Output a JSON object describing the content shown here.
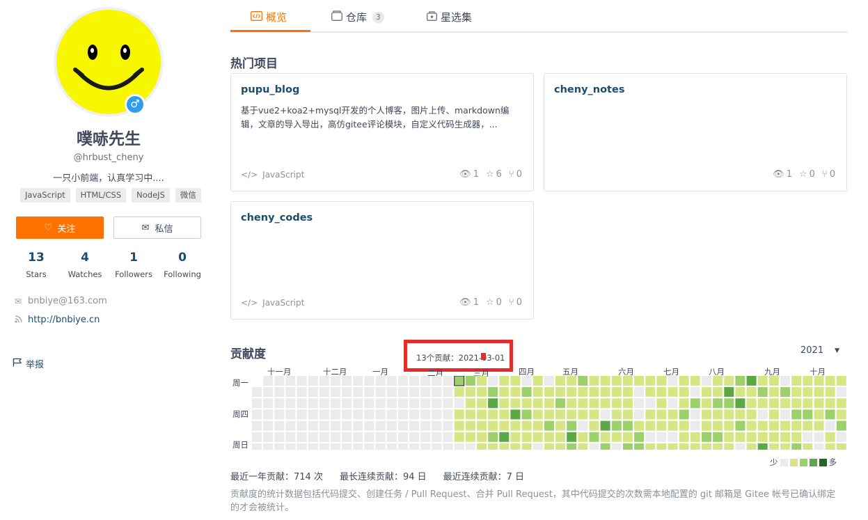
{
  "profile": {
    "name": "噗哧先生",
    "handle": "@hrbust_cheny",
    "bio": "一只小前端，认真学习中....",
    "tags": [
      "JavaScript",
      "HTML/CSS",
      "NodeJS",
      "微信"
    ],
    "follow_label": "关注",
    "message_label": "私信",
    "stats": [
      {
        "value": "13",
        "label": "Stars"
      },
      {
        "value": "4",
        "label": "Watches"
      },
      {
        "value": "1",
        "label": "Followers"
      },
      {
        "value": "0",
        "label": "Following"
      }
    ],
    "email": "bnbiye@163.com",
    "website": "http://bnbiye.cn",
    "report_label": "举报",
    "avatar_color": "#f7f700",
    "accent_color": "#fe7300"
  },
  "tabs": [
    {
      "label": "概览",
      "active": true
    },
    {
      "label": "仓库",
      "count": "3"
    },
    {
      "label": "星选集"
    }
  ],
  "hot_projects": {
    "title": "热门项目",
    "projects": [
      {
        "name": "pupu_blog",
        "desc": "基于vue2+koa2+mysql开发的个人博客，图片上传、markdown编辑，文章的导入导出，高仿gitee评论模块，自定义代码生成器，...",
        "lang": "JavaScript",
        "watches": "1",
        "stars": "6",
        "forks": "0"
      },
      {
        "name": "cheny_notes",
        "desc": "",
        "lang": "",
        "watches": "1",
        "stars": "0",
        "forks": "0"
      },
      {
        "name": "cheny_codes",
        "desc": "",
        "lang": "JavaScript",
        "watches": "1",
        "stars": "0",
        "forks": "0"
      }
    ]
  },
  "contribution": {
    "title": "贡献度",
    "year": "2021",
    "tooltip": "13个贡献：2021-03-01",
    "months": [
      "十一月",
      "十二月",
      "一月",
      "二月",
      "三月",
      "四月",
      "五月",
      "六月",
      "七月",
      "八月",
      "九月",
      "十月"
    ],
    "day_labels": [
      "周一",
      "周四",
      "周日"
    ],
    "legend_less": "少",
    "legend_more": "多",
    "level_colors": [
      "#ebebeb",
      "#d6e685",
      "#9cd06b",
      "#5aa945",
      "#1e6823"
    ],
    "summary": {
      "year_total": "最近一年贡献：714 次",
      "longest_streak": "最长连续贡献：94 日",
      "current_streak": "最近连续贡献：7 日"
    },
    "note": "贡献度的统计数据包括代码提交、创建任务 / Pull Request、合并 Pull Request，其中代码提交的次数需本地配置的 git 邮箱是 Gitee 帐号已确认绑定的才会被统计。"
  }
}
